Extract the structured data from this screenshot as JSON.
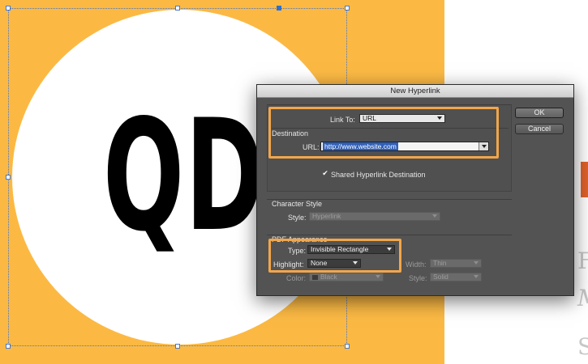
{
  "artwork": {
    "logo_text": "QD",
    "peek_letters": [
      "F",
      "M",
      "S"
    ],
    "colors": {
      "background": "#fbb944",
      "circle": "#ffffff",
      "accent": "#e0622a",
      "highlight": "#f2a64b"
    }
  },
  "dialog": {
    "title": "New Hyperlink",
    "link_to": {
      "label": "Link To:",
      "value": "URL"
    },
    "destination": {
      "title": "Destination",
      "url_label": "URL:",
      "url_value": "http://www.website.com",
      "shared_label": "Shared Hyperlink Destination",
      "shared_checked": true
    },
    "character_style": {
      "title": "Character Style",
      "style_label": "Style:",
      "style_value": "Hyperlink"
    },
    "pdf_appearance": {
      "title": "PDF Appearance",
      "type_label": "Type:",
      "type_value": "Invisible Rectangle",
      "highlight_label": "Highlight:",
      "highlight_value": "None",
      "width_label": "Width:",
      "width_value": "Thin",
      "color_label": "Color:",
      "color_value": "Black",
      "style_label": "Style:",
      "style_value": "Solid"
    },
    "buttons": {
      "ok": "OK",
      "cancel": "Cancel"
    }
  }
}
